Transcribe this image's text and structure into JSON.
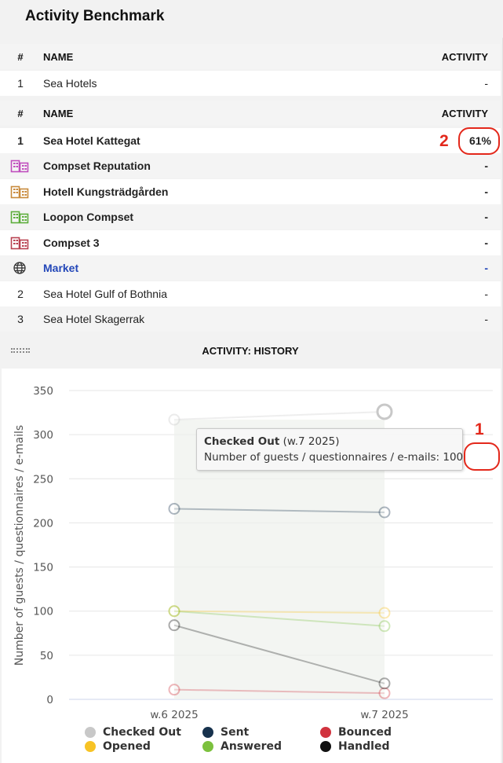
{
  "page_title": "Activity Benchmark",
  "table1": {
    "header": {
      "num": "#",
      "name": "NAME",
      "activity": "ACTIVITY"
    },
    "rows": [
      {
        "num": "1",
        "name": "Sea Hotels",
        "activity": "-"
      }
    ]
  },
  "table2": {
    "header": {
      "num": "#",
      "name": "NAME",
      "activity": "ACTIVITY"
    },
    "main_row": {
      "num": "1",
      "name": "Sea Hotel Kattegat",
      "activity": "61%"
    },
    "groups": [
      {
        "name": "Compset Reputation",
        "activity": "-",
        "icon": "building-icon",
        "color": "#c04dbd"
      },
      {
        "name": "Hotell Kungsträdgården",
        "activity": "-",
        "icon": "building-icon",
        "color": "#c98a3c"
      },
      {
        "name": "Loopon Compset",
        "activity": "-",
        "icon": "building-icon",
        "color": "#5cad3b"
      },
      {
        "name": "Compset 3",
        "activity": "-",
        "icon": "building-icon",
        "color": "#b84151"
      },
      {
        "name": "Market",
        "activity": "-",
        "icon": "globe-icon",
        "color": "#2347b8"
      }
    ],
    "other_rows": [
      {
        "num": "2",
        "name": "Sea Hotel Gulf of Bothnia",
        "activity": "-"
      },
      {
        "num": "3",
        "name": "Sea Hotel Skagerrak",
        "activity": "-"
      }
    ]
  },
  "annotations": {
    "one": "1",
    "two": "2",
    "accent": "#e3281b"
  },
  "history": {
    "title": "ACTIVITY: HISTORY",
    "tooltip": {
      "series": "Checked Out",
      "period": "(w.7 2025)",
      "label": "Number of guests / questionnaires / e-mails:",
      "value": "100"
    }
  },
  "chart_data": {
    "type": "line",
    "x": [
      "w.6 2025",
      "w.7 2025"
    ],
    "ylabel": "Number of guests / questionnaires / e-mails",
    "ylim": [
      0,
      350
    ],
    "yticks": [
      0,
      50,
      100,
      150,
      200,
      250,
      300,
      350
    ],
    "grid": "horizontal",
    "legend_position": "bottom",
    "series": [
      {
        "name": "Checked Out",
        "color": "#c8c8c8",
        "values": [
          317,
          326
        ]
      },
      {
        "name": "Sent",
        "color": "#17324d",
        "values": [
          216,
          212
        ]
      },
      {
        "name": "Bounced",
        "color": "#d1333e",
        "values": [
          11,
          7
        ]
      },
      {
        "name": "Opened",
        "color": "#f7c325",
        "values": [
          100,
          98
        ]
      },
      {
        "name": "Answered",
        "color": "#7cc13e",
        "values": [
          100,
          83
        ]
      },
      {
        "name": "Handled",
        "color": "#111111",
        "values": [
          84,
          18
        ]
      }
    ]
  }
}
